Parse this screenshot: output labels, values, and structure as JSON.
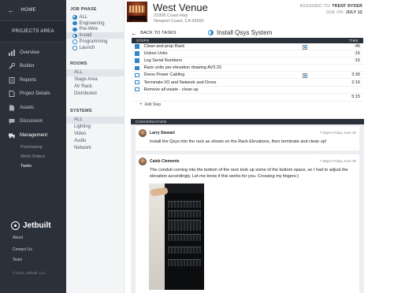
{
  "sidebar": {
    "home_label": "HOME",
    "projects_area": "PROJECTS AREA",
    "nav": [
      {
        "label": "Overview"
      },
      {
        "label": "Builder"
      },
      {
        "label": "Reports"
      },
      {
        "label": "Project Details"
      },
      {
        "label": "Assets"
      },
      {
        "label": "Discussion"
      },
      {
        "label": "Management"
      }
    ],
    "management_sub": [
      {
        "label": "Purchasing"
      },
      {
        "label": "Work Orders"
      },
      {
        "label": "Tasks"
      }
    ],
    "brand": "Jetbuilt",
    "footer_links": [
      "About",
      "Contact Us",
      "Team"
    ],
    "copyright": "© 2015, Jetbuilt, LLC."
  },
  "filters": {
    "job_phase_title": "JOB PHASE",
    "job_phase": [
      "ALL",
      "Engineering",
      "Pre-Wire",
      "Install",
      "Programming",
      "Launch"
    ],
    "rooms_title": "ROOMS",
    "rooms": [
      "ALL",
      "Stage Area",
      "AV Rack",
      "Distributed"
    ],
    "systems_title": "SYSTEMS",
    "systems": [
      "ALL",
      "Lighting",
      "Video",
      "Audio",
      "Network"
    ]
  },
  "header": {
    "venue": "West Venue",
    "address_line1": "23358 Coast Hwy",
    "address_line2": "Newport Coast, CA 92660",
    "assigned_label": "ASSIGNED TO:",
    "assigned_to": "TRENT RYDER",
    "due_label": "DUE ON:",
    "due_on": "JULY 12"
  },
  "task": {
    "back_label": "BACK TO TASKS",
    "title": "Install Qsys System"
  },
  "steps": {
    "col_steps": "STEPS",
    "col_time": "TIME",
    "rows": [
      {
        "label": "Clean and prep Rack",
        "time": ":45",
        "done": true,
        "attachment": true
      },
      {
        "label": "Unbox Units",
        "time": ":15",
        "done": true,
        "attachment": false
      },
      {
        "label": "Log Serial Numbers",
        "time": ":15",
        "done": true,
        "attachment": false
      },
      {
        "label": "Rack units per elevation drawing AV3.20",
        "time": "",
        "done": true,
        "attachment": false
      },
      {
        "label": "Dress Power Cabling",
        "time": "3:30",
        "done": false,
        "attachment": true
      },
      {
        "label": "Terminate I/O and Network and Dress",
        "time": "2:15",
        "done": false,
        "attachment": false
      },
      {
        "label": "Remove all waste - clean up",
        "time": "",
        "done": false,
        "attachment": false
      }
    ],
    "total": "5:15",
    "add_step": "Add Step"
  },
  "conversation": {
    "title": "CONVERSATION",
    "messages": [
      {
        "author": "Larry Stewart",
        "stamp": "7:36pm  Friday June 30",
        "text": "Install the Qsys into the rack as shown on the Rack Elevations, then terminate and clean up!"
      },
      {
        "author": "Caleb Clements",
        "stamp": "7:36pm  Friday June 30",
        "text": "The conduit coming into the bottom of the rack took up some of the bottom space, so I had to adjust the elevation accordingly.  Let me know if this works for you. Crossing my fingers:)"
      }
    ]
  },
  "colors": {
    "sidebar_bg": "#2b313a",
    "accent_blue": "#2e86c8",
    "header_dark": "#2b313a"
  },
  "icons": {
    "home": "back-arrow-icon",
    "overview": "bar-chart-icon",
    "builder": "wrench-icon",
    "reports": "document-icon",
    "project_details": "file-icon",
    "assets": "pdf-icon",
    "discussion": "chat-bubble-icon",
    "management": "truck-icon"
  }
}
